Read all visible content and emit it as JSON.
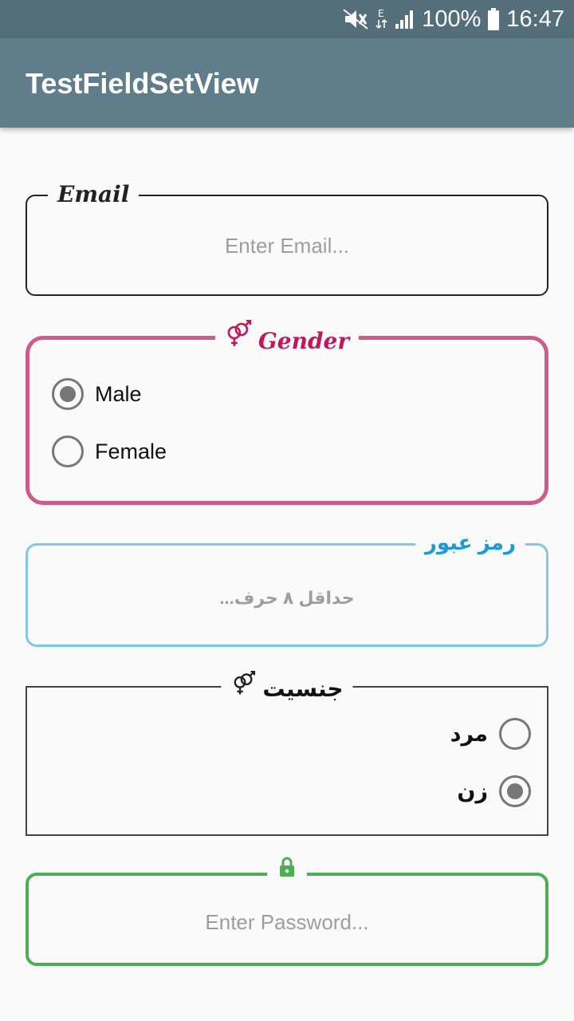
{
  "status_bar": {
    "battery": "100%",
    "time": "16:47"
  },
  "app_bar": {
    "title": "TestFieldSetView"
  },
  "email_field": {
    "legend": "Email",
    "placeholder": "Enter Email..."
  },
  "gender_field": {
    "legend": "Gender",
    "options": [
      {
        "label": "Male",
        "checked": true
      },
      {
        "label": "Female",
        "checked": false
      }
    ]
  },
  "password_fa_field": {
    "legend": "رمز عبور",
    "placeholder": "حداقل ۸ حرف..."
  },
  "gender_fa_field": {
    "legend": "جنسیت",
    "options": [
      {
        "label": "مرد",
        "checked": false
      },
      {
        "label": "زن",
        "checked": true
      }
    ]
  },
  "password_field": {
    "placeholder": "Enter Password..."
  },
  "colors": {
    "toolbar": "#607d8b",
    "status": "#546e7a",
    "gender": "#d05a88",
    "blue": "#7ec8e8",
    "green": "#4caf50"
  }
}
